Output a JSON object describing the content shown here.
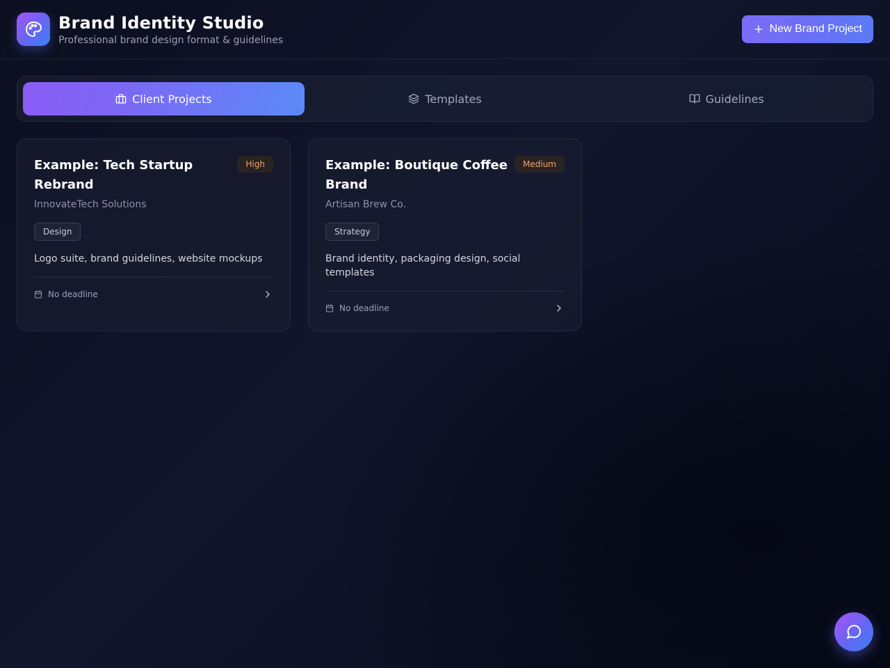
{
  "header": {
    "title": "Brand Identity Studio",
    "subtitle": "Professional brand design format & guidelines",
    "logo_icon": "palette-icon",
    "new_button": {
      "icon": "plus-icon",
      "label": "New Brand Project"
    }
  },
  "tabs": [
    {
      "label": "Client Projects",
      "icon": "briefcase-icon",
      "active": true
    },
    {
      "label": "Templates",
      "icon": "layers-icon",
      "active": false
    },
    {
      "label": "Guidelines",
      "icon": "book-open-icon",
      "active": false
    }
  ],
  "projects": [
    {
      "title": "Example: Tech Startup Rebrand",
      "priority": "High",
      "client": "InnovateTech Solutions",
      "tag": "Design",
      "description": "Logo suite, brand guidelines, website mockups",
      "deadline": "No deadline"
    },
    {
      "title": "Example: Boutique Coffee Brand",
      "priority": "Medium",
      "client": "Artisan Brew Co.",
      "tag": "Strategy",
      "description": "Brand identity, packaging design, social templates",
      "deadline": "No deadline"
    }
  ],
  "fab": {
    "icon": "message-circle-icon"
  },
  "colors": {
    "accent_start": "#a855f7",
    "accent_end": "#3b82f6",
    "priority_text": "#f0a45c",
    "background": "#0b0f1f"
  }
}
